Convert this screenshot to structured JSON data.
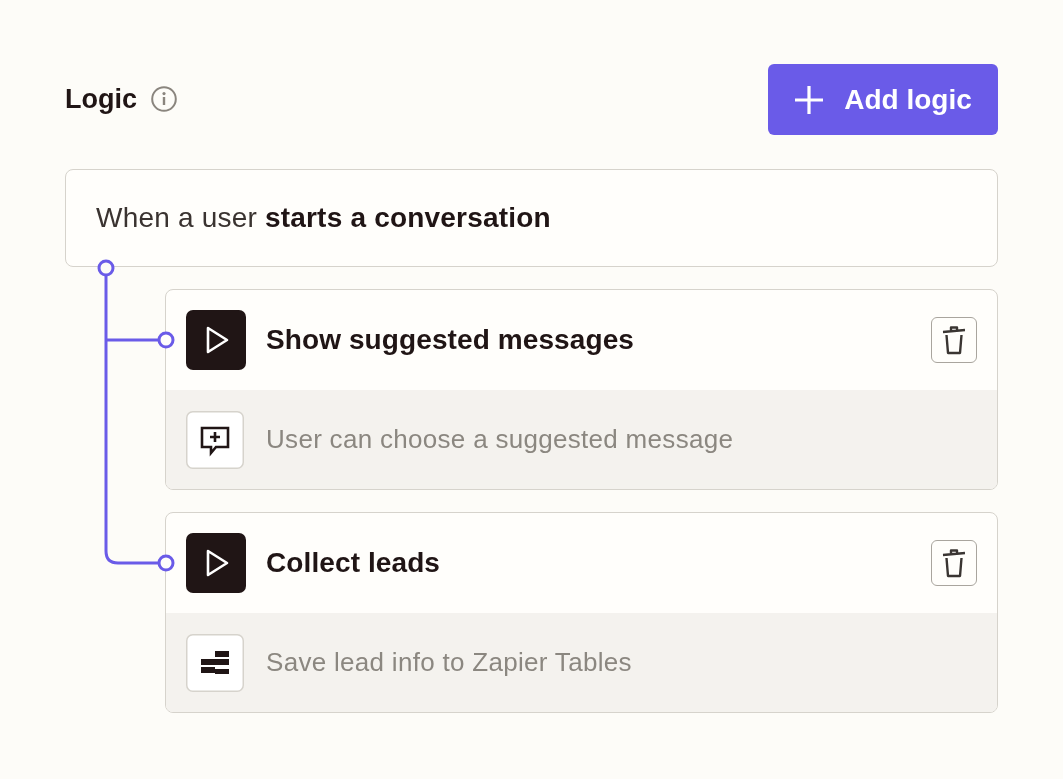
{
  "header": {
    "title": "Logic",
    "add_button": {
      "label": "Add logic"
    }
  },
  "trigger": {
    "text": "When a user **starts a conversation**"
  },
  "actions": [
    {
      "title": "Show suggested messages",
      "detail": {
        "kind": "suggested_message",
        "text": "User can choose a suggested message"
      }
    },
    {
      "title": "Collect leads",
      "detail": {
        "kind": "table",
        "text": "Save lead info to Zapier Tables"
      }
    }
  ]
}
